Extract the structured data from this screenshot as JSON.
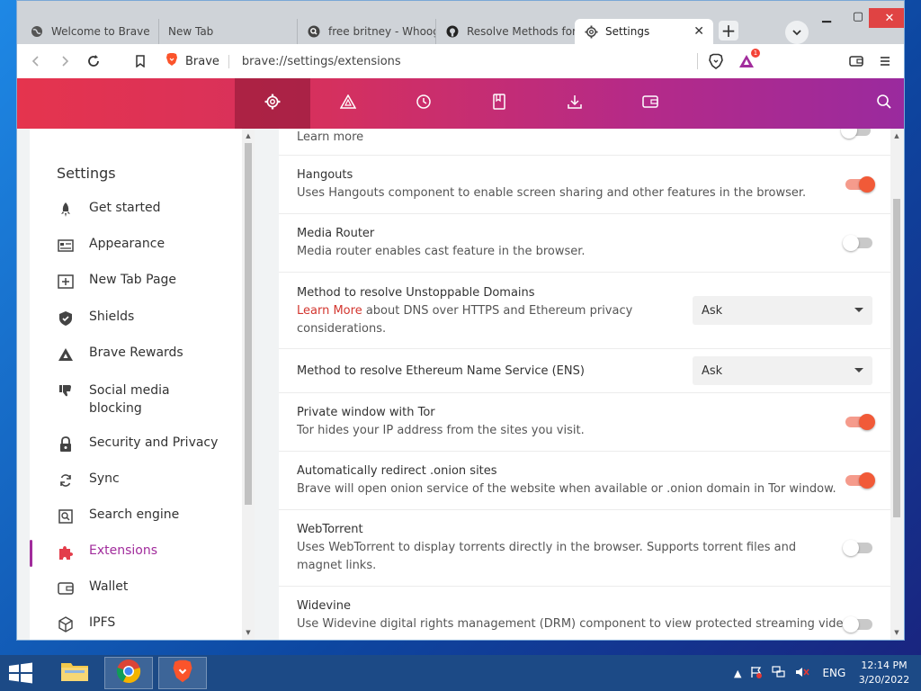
{
  "browser": {
    "tabs": [
      {
        "title": "Welcome to Brave",
        "icon": "globe-icon"
      },
      {
        "title": "New Tab",
        "icon": "none"
      },
      {
        "title": "free britney - Whoog",
        "icon": "search-icon"
      },
      {
        "title": "Resolve Methods for (",
        "icon": "github-icon"
      },
      {
        "title": "Settings",
        "icon": "gear-icon",
        "active": true
      }
    ],
    "toolbar": {
      "site_label": "Brave",
      "url": "brave://settings/extensions",
      "rewards_badge": "1"
    }
  },
  "sidebar": {
    "title": "Settings",
    "items": [
      {
        "label": "Get started",
        "icon": "rocket-icon"
      },
      {
        "label": "Appearance",
        "icon": "appearance-icon"
      },
      {
        "label": "New Tab Page",
        "icon": "new-tab-page-icon"
      },
      {
        "label": "Shields",
        "icon": "shield-icon"
      },
      {
        "label": "Brave Rewards",
        "icon": "rewards-triangle-icon"
      },
      {
        "label": "Social media blocking",
        "icon": "thumbs-down-icon"
      },
      {
        "label": "Security and Privacy",
        "icon": "lock-icon"
      },
      {
        "label": "Sync",
        "icon": "sync-icon"
      },
      {
        "label": "Search engine",
        "icon": "search-engine-icon"
      },
      {
        "label": "Extensions",
        "icon": "puzzle-icon",
        "active": true
      },
      {
        "label": "Wallet",
        "icon": "wallet-icon"
      },
      {
        "label": "IPFS",
        "icon": "cube-icon"
      }
    ]
  },
  "settings": {
    "learn_more_top": "Learn more",
    "rows": [
      {
        "title": "Hangouts",
        "desc": "Uses Hangouts component to enable screen sharing and other features in the browser.",
        "toggle": "on"
      },
      {
        "title": "Media Router",
        "desc": "Media router enables cast feature in the browser.",
        "toggle": "off"
      },
      {
        "title": "Method to resolve Unstoppable Domains",
        "desc_link": "Learn More",
        "desc": " about DNS over HTTPS and Ethereum privacy considerations.",
        "select": "Ask"
      },
      {
        "title": "Method to resolve Ethereum Name Service (ENS)",
        "select": "Ask"
      },
      {
        "title": "Private window with Tor",
        "desc": "Tor hides your IP address from the sites you visit.",
        "toggle": "on"
      },
      {
        "title": "Automatically redirect .onion sites",
        "desc": "Brave will open onion service of the website when available or .onion domain in Tor window.",
        "toggle": "on"
      },
      {
        "title": "WebTorrent",
        "desc": "Uses WebTorrent to display torrents directly in the browser. Supports torrent files and magnet links.",
        "toggle": "off"
      },
      {
        "title": "Widevine",
        "desc": "Use Widevine digital rights management (DRM) component to view protected streaming video",
        "toggle": "off"
      }
    ]
  },
  "taskbar": {
    "language": "ENG",
    "time": "12:14 PM",
    "date": "3/20/2022"
  },
  "colors": {
    "accent": "#a12c9c",
    "toggle_on": "#f15a38",
    "link": "#d3362f"
  }
}
